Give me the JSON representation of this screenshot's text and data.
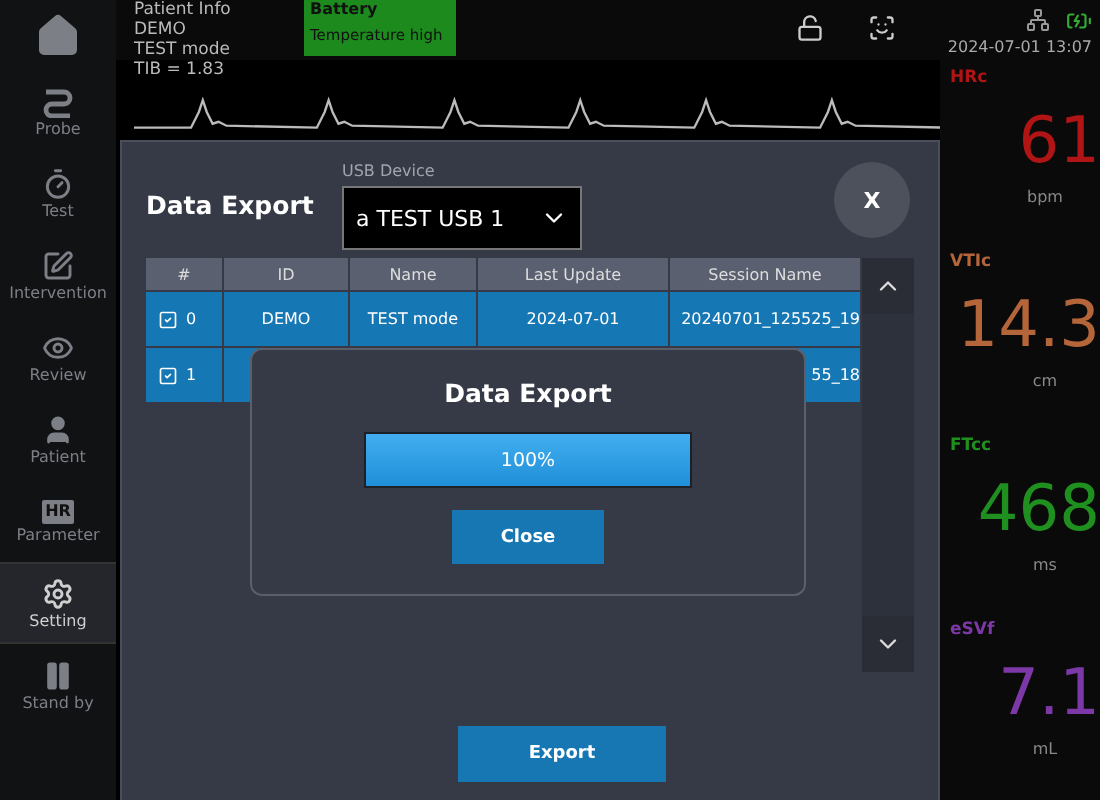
{
  "sidebar": {
    "items": [
      {
        "kind": "home",
        "selected": false
      },
      {
        "kind": "probe",
        "label": "Probe",
        "selected": false
      },
      {
        "kind": "test",
        "label": "Test",
        "selected": false
      },
      {
        "kind": "intervention",
        "label": "Intervention",
        "selected": false
      },
      {
        "kind": "review",
        "label": "Review",
        "selected": false
      },
      {
        "kind": "patient",
        "label": "Patient",
        "selected": false
      },
      {
        "kind": "badge",
        "badge": "HR",
        "label": "Parameter",
        "selected": false
      },
      {
        "kind": "setting",
        "label": "Setting",
        "selected": true
      },
      {
        "kind": "standby",
        "label": "Stand by",
        "selected": false
      }
    ]
  },
  "patient_info": [
    "Patient Info",
    "DEMO",
    "TEST mode"
  ],
  "alert": {
    "title": "Battery",
    "message": "Temperature high"
  },
  "status": {
    "datetime": "2024-07-01 13:07"
  },
  "waveform": {
    "label": "TIB = 1.83"
  },
  "dialog": {
    "title": "Data Export",
    "usb_label": "USB Device",
    "usb_value": "a TEST USB 1",
    "close": "X",
    "table": {
      "columns": [
        "#",
        "ID",
        "Name",
        "Last Update",
        "Session Name"
      ],
      "rows": [
        {
          "checked": true,
          "number": "0",
          "id": "DEMO",
          "name": "TEST mode",
          "last_update": "2024-07-01",
          "session_name": "20240701_125525_19"
        },
        {
          "checked": true,
          "number": "1",
          "session_name": "55_18"
        }
      ]
    },
    "export": "Export",
    "progress": {
      "title": "Data Export",
      "level": 1,
      "reading": "100%",
      "close": "Close"
    }
  },
  "metrics": [
    {
      "label": "HRc",
      "value": "61",
      "unit": "bpm",
      "color": "#b01414"
    },
    {
      "label": "VTIc",
      "value": "14.3",
      "unit": "cm",
      "color": "#b5653a"
    },
    {
      "label": "FTcc",
      "value": "468",
      "unit": "ms",
      "color": "#1f8f1f"
    },
    {
      "label": "eSVf",
      "value": "7.1",
      "unit": "mL",
      "color": "#7d38a8"
    }
  ]
}
